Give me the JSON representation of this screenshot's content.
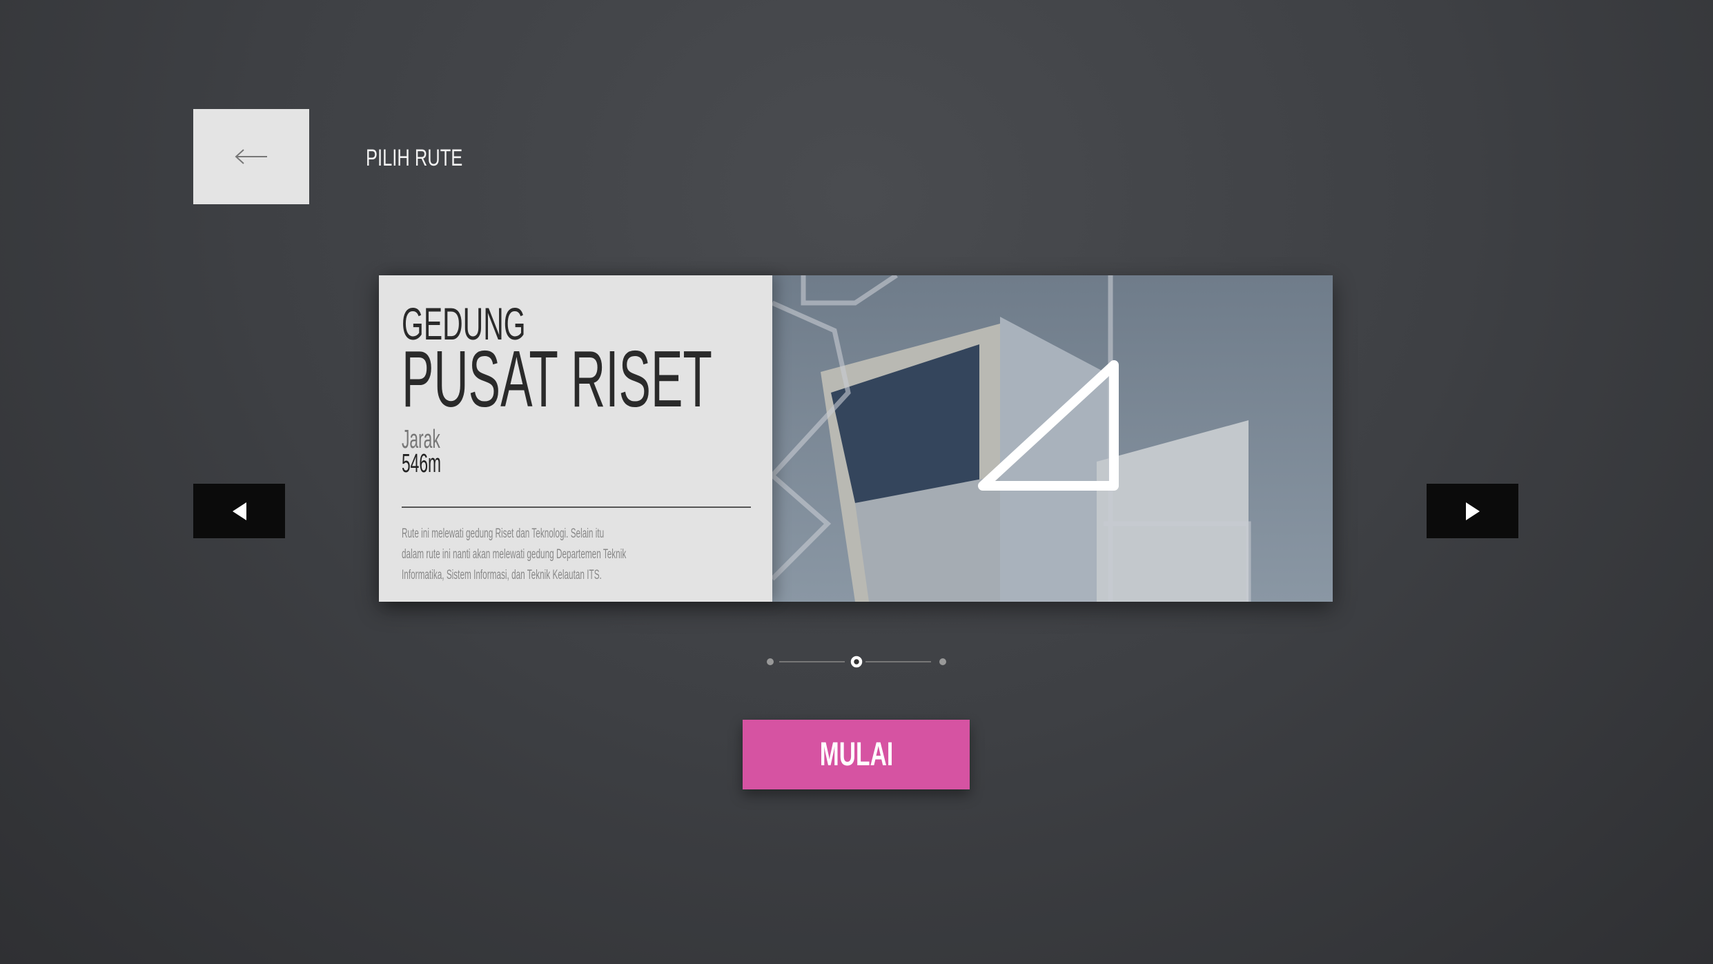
{
  "header": {
    "title": "PILIH RUTE",
    "back_icon": "arrow-left-icon"
  },
  "route": {
    "label_small": "GEDUNG",
    "name": "PUSAT RISET",
    "distance_label": "Jarak",
    "distance_value": "546m",
    "description": [
      "Rute ini melewati gedung Riset dan Teknologi. Selain itu",
      "dalam rute ini nanti akan melewati gedung Departemen Teknik",
      "Informatika, Sistem Informasi, dan Teknik Kelautan ITS."
    ]
  },
  "carousel": {
    "total": 3,
    "active_index": 1,
    "prev_icon": "triangle-left-icon",
    "next_icon": "triangle-right-icon"
  },
  "start_button": {
    "label": "MULAI"
  },
  "colors": {
    "accent": "#d653a2",
    "background": "#3e4044",
    "card": "#e3e3e3"
  }
}
